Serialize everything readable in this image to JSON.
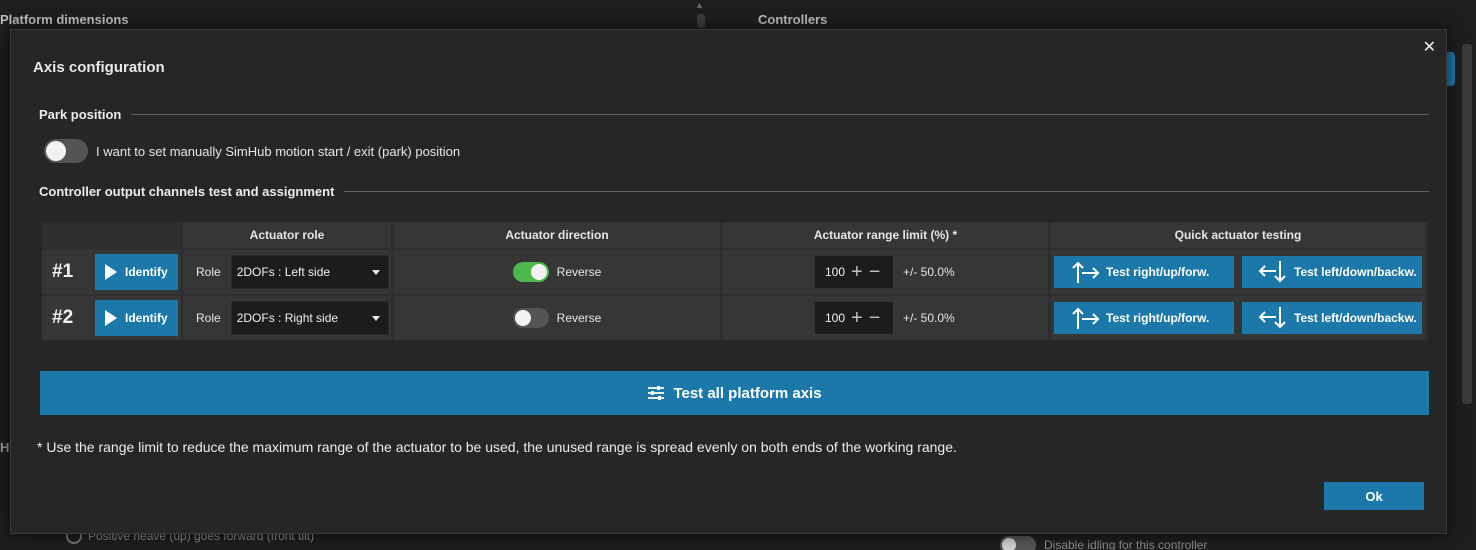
{
  "background": {
    "left_title": "Platform dimensions",
    "right_title": "Controllers",
    "left_letter": "H",
    "bottom_left_option": "Positive heave (up) goes forward (front tilt)",
    "bottom_right_option": "Disable idling for this controller"
  },
  "modal": {
    "title": "Axis configuration",
    "close_label": "✕",
    "park": {
      "section_title": "Park position",
      "toggle_label": "I want to set manually SimHub motion start / exit (park) position",
      "toggle_on": false
    },
    "channels": {
      "section_title": "Controller output channels test and assignment",
      "headers": {
        "role": "Actuator role",
        "direction": "Actuator direction",
        "range": "Actuator range limit (%) *",
        "quick": "Quick actuator testing"
      },
      "rows": [
        {
          "number": "#1",
          "identify_label": "Identify",
          "role_label": "Role",
          "role_value": "2DOFs : Left side",
          "reverse_label": "Reverse",
          "reverse_on": true,
          "range_value": "100",
          "range_text": "+/- 50.0%",
          "test_forward_label": "Test right/up/forw.",
          "test_backward_label": "Test left/down/backw."
        },
        {
          "number": "#2",
          "identify_label": "Identify",
          "role_label": "Role",
          "role_value": "2DOFs : Right side",
          "reverse_label": "Reverse",
          "reverse_on": false,
          "range_value": "100",
          "range_text": "+/- 50.0%",
          "test_forward_label": "Test right/up/forw.",
          "test_backward_label": "Test left/down/backw."
        }
      ]
    },
    "test_all_label": "Test all platform axis",
    "footnote": "* Use the range limit to reduce the maximum range of the actuator to be used, the unused range is spread evenly on both ends of the working range.",
    "ok_label": "Ok"
  },
  "colors": {
    "accent": "#1b78a8",
    "toggle_on": "#4cb84c",
    "background": "#1e1e1e",
    "modal": "#262626"
  },
  "icons": {
    "play": "play-icon",
    "sliders": "sliders-icon",
    "arrow_up_right": "arrows-up-right-icon",
    "arrow_down_left": "arrows-down-left-icon",
    "close": "close-icon",
    "caret": "chevron-down-icon"
  }
}
